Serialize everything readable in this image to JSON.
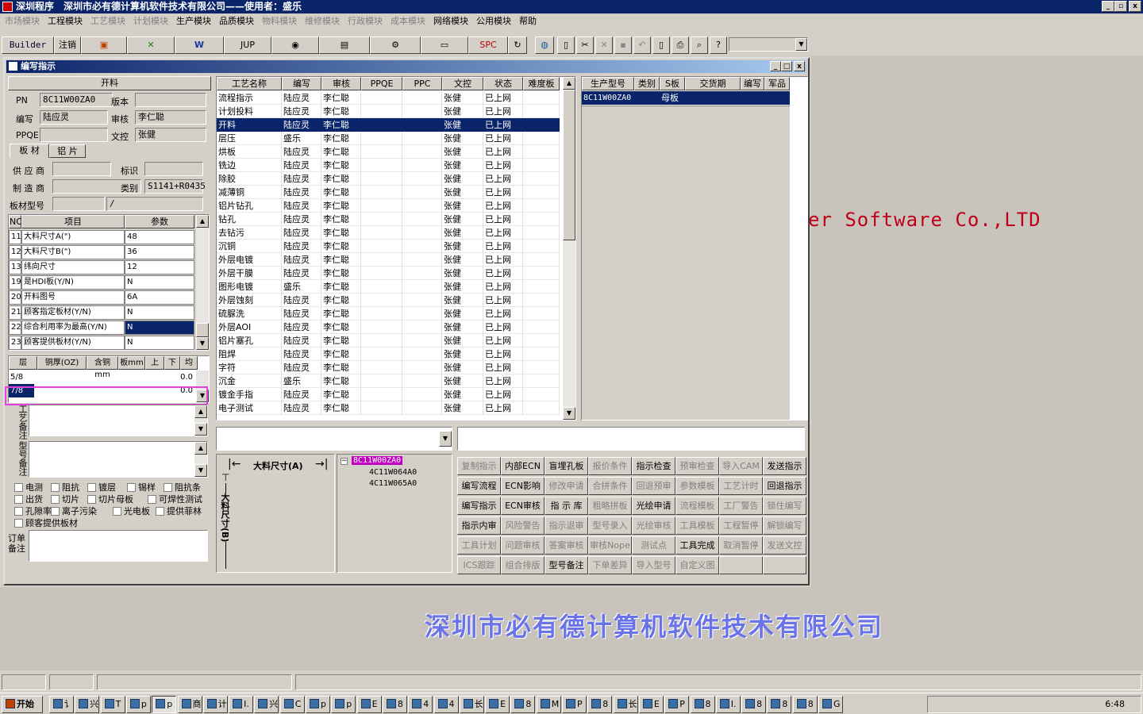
{
  "app": {
    "title": "深圳程序　深圳市必有德计算机软件技术有限公司——使用者：盛乐"
  },
  "menu": [
    {
      "label": "市场模块",
      "dim": true
    },
    {
      "label": "工程模块",
      "dim": false
    },
    {
      "label": "工艺模块",
      "dim": true
    },
    {
      "label": "计划模块",
      "dim": true
    },
    {
      "label": "生产模块",
      "dim": false
    },
    {
      "label": "品质模块",
      "dim": false
    },
    {
      "label": "物料模块",
      "dim": true
    },
    {
      "label": "维修模块",
      "dim": true
    },
    {
      "label": "行政模块",
      "dim": true
    },
    {
      "label": "成本模块",
      "dim": true
    },
    {
      "label": "网络模块",
      "dim": false
    },
    {
      "label": "公用模块",
      "dim": false
    },
    {
      "label": "帮助",
      "dim": false
    }
  ],
  "toolbar": {
    "builder": "Builder",
    "logout": "注销",
    "jup": "JUP",
    "spc": "SPC"
  },
  "desktop": {
    "banner": "er Software Co.,LTD",
    "company": "深圳市必有德计算机软件技术有限公司"
  },
  "window": {
    "title": "编写指示",
    "kailiao": "开料",
    "pn_label": "PN",
    "pn": "8C11W00ZA0",
    "ver_label": "版本",
    "ver": "",
    "writer_label": "编写",
    "writer": "陆应灵",
    "review_label": "审核",
    "review": "李仁聪",
    "ppqe_label": "PPQE",
    "ppqe": "",
    "doc_label": "文控",
    "doc": "张健",
    "tab1": "板 材",
    "tab2": "铝 片",
    "supplier_label": "供 应 商",
    "supplier": "",
    "mark_label": "标识",
    "mark": "",
    "maker_label": "制 造 商",
    "maker": "",
    "type_label": "类别",
    "type": "S1141+R0435",
    "model_label": "板材型号",
    "model": "",
    "model2": "/",
    "param_headers": [
      "NO",
      "项目",
      "参数"
    ],
    "params": [
      [
        "11",
        "大料尺寸A(\")",
        "48"
      ],
      [
        "12",
        "大料尺寸B(\")",
        "36"
      ],
      [
        "13",
        "纬向尺寸",
        "12"
      ],
      [
        "19",
        "是HDI板(Y/N)",
        "N"
      ],
      [
        "20",
        "开料图号",
        "6A"
      ],
      [
        "21",
        "顾客指定板材(Y/N)",
        "N"
      ],
      [
        "22",
        "综合利用率为最高(Y/N)",
        "N"
      ],
      [
        "23",
        "顾客提供板材(Y/N)",
        "N"
      ]
    ],
    "layer_headers": [
      "层",
      "铜厚(OZ)",
      "含铜mm",
      "板mm",
      "上",
      "下",
      "均"
    ],
    "layers": [
      [
        "5/8",
        "0.0"
      ],
      [
        "7/8",
        "0.0"
      ]
    ],
    "side_label1": "工艺备注",
    "side_label2": "型号备注",
    "side_label3": "订单备注",
    "checks": [
      "电测",
      "阻抗",
      "镀层",
      "锡样",
      "阻抗条",
      "出货",
      "切片",
      "切片母板",
      "可焊性测试",
      "孔隙率",
      "离子污染",
      "光电板",
      "提供菲林",
      "顾客提供板材"
    ],
    "proc_headers": [
      "工艺名称",
      "编写",
      "审核",
      "PPQE",
      "PPC",
      "文控",
      "状态",
      "难度板"
    ],
    "procs": [
      [
        "流程指示",
        "陆应灵",
        "李仁聪",
        "",
        "",
        "张健",
        "已上网"
      ],
      [
        "计划投料",
        "陆应灵",
        "李仁聪",
        "",
        "",
        "张健",
        "已上网"
      ],
      [
        "开料",
        "陆应灵",
        "李仁聪",
        "",
        "",
        "张健",
        "已上网"
      ],
      [
        "层压",
        "盛乐",
        "李仁聪",
        "",
        "",
        "张健",
        "已上网"
      ],
      [
        "烘板",
        "陆应灵",
        "李仁聪",
        "",
        "",
        "张健",
        "已上网"
      ],
      [
        "铣边",
        "陆应灵",
        "李仁聪",
        "",
        "",
        "张健",
        "已上网"
      ],
      [
        "除胶",
        "陆应灵",
        "李仁聪",
        "",
        "",
        "张健",
        "已上网"
      ],
      [
        "减薄铜",
        "陆应灵",
        "李仁聪",
        "",
        "",
        "张健",
        "已上网"
      ],
      [
        "铝片钻孔",
        "陆应灵",
        "李仁聪",
        "",
        "",
        "张健",
        "已上网"
      ],
      [
        "钻孔",
        "陆应灵",
        "李仁聪",
        "",
        "",
        "张健",
        "已上网"
      ],
      [
        "去钻污",
        "陆应灵",
        "李仁聪",
        "",
        "",
        "张健",
        "已上网"
      ],
      [
        "沉铜",
        "陆应灵",
        "李仁聪",
        "",
        "",
        "张健",
        "已上网"
      ],
      [
        "外层电镀",
        "陆应灵",
        "李仁聪",
        "",
        "",
        "张健",
        "已上网"
      ],
      [
        "外层干膜",
        "陆应灵",
        "李仁聪",
        "",
        "",
        "张健",
        "已上网"
      ],
      [
        "图形电镀",
        "盛乐",
        "李仁聪",
        "",
        "",
        "张健",
        "已上网"
      ],
      [
        "外层蚀刻",
        "陆应灵",
        "李仁聪",
        "",
        "",
        "张健",
        "已上网"
      ],
      [
        "硫脲洗",
        "陆应灵",
        "李仁聪",
        "",
        "",
        "张健",
        "已上网"
      ],
      [
        "外层AOI",
        "陆应灵",
        "李仁聪",
        "",
        "",
        "张健",
        "已上网"
      ],
      [
        "铝片塞孔",
        "陆应灵",
        "李仁聪",
        "",
        "",
        "张健",
        "已上网"
      ],
      [
        "阻焊",
        "陆应灵",
        "李仁聪",
        "",
        "",
        "张健",
        "已上网"
      ],
      [
        "字符",
        "陆应灵",
        "李仁聪",
        "",
        "",
        "张健",
        "已上网"
      ],
      [
        "沉金",
        "盛乐",
        "李仁聪",
        "",
        "",
        "张健",
        "已上网"
      ],
      [
        "镀金手指",
        "陆应灵",
        "李仁聪",
        "",
        "",
        "张健",
        "已上网"
      ],
      [
        "电子测试",
        "陆应灵",
        "李仁聪",
        "",
        "",
        "张健",
        "已上网"
      ]
    ],
    "prod_headers": [
      "生产型号",
      "类别",
      "S板",
      "交货期",
      "编写",
      "军品"
    ],
    "prod_rows": [
      [
        "8C11W00ZA0",
        "",
        "母板",
        "",
        "",
        ""
      ]
    ],
    "dimA": "大料尺寸(A)",
    "dimB": "大料尺寸(B)",
    "tree": [
      "8C11W00ZA0",
      "4C11W064A0",
      "4C11W065A0"
    ],
    "actions": [
      [
        [
          "复制指示",
          true
        ],
        [
          "内部ECN",
          false
        ],
        [
          "盲埋孔板",
          false
        ],
        [
          "报价条件",
          true
        ],
        [
          "指示检查",
          false
        ],
        [
          "预审检查",
          true
        ],
        [
          "导入CAM",
          true
        ],
        [
          "发送指示",
          false
        ]
      ],
      [
        [
          "编写流程",
          false
        ],
        [
          "ECN影响",
          false
        ],
        [
          "修改申请",
          true
        ],
        [
          "合拼条件",
          true
        ],
        [
          "回退预审",
          true
        ],
        [
          "参数模板",
          true
        ],
        [
          "工艺计时",
          true
        ],
        [
          "回退指示",
          false
        ]
      ],
      [
        [
          "编写指示",
          false
        ],
        [
          "ECN审核",
          false
        ],
        [
          "指 示 库",
          false
        ],
        [
          "粗略拼板",
          true
        ],
        [
          "光绘申请",
          false
        ],
        [
          "流程模板",
          true
        ],
        [
          "工厂警告",
          true
        ],
        [
          "锁住编写",
          true
        ]
      ],
      [
        [
          "指示内审",
          false
        ],
        [
          "风险警告",
          true
        ],
        [
          "指示退审",
          true
        ],
        [
          "型号录入",
          true
        ],
        [
          "光绘审核",
          true
        ],
        [
          "工具模板",
          true
        ],
        [
          "工程暂停",
          true
        ],
        [
          "解锁编写",
          true
        ]
      ],
      [
        [
          "工具计划",
          true
        ],
        [
          "问题审核",
          true
        ],
        [
          "答案审核",
          true
        ],
        [
          "审核Nope",
          true
        ],
        [
          "测试点",
          true
        ],
        [
          "工具完成",
          false
        ],
        [
          "取消暂停",
          true
        ],
        [
          "发送文控",
          true
        ]
      ],
      [
        [
          "ICS跟踪",
          true
        ],
        [
          "组合排版",
          true
        ],
        [
          "型号备注",
          false
        ],
        [
          "下单差异",
          true
        ],
        [
          "导入型号",
          true
        ],
        [
          "自定义图",
          true
        ],
        [
          "",
          false
        ],
        [
          "",
          false
        ]
      ]
    ]
  },
  "taskbar": {
    "start": "开始",
    "clock": "6:48",
    "items": [
      "讠",
      "兴",
      "T",
      "p",
      "p",
      "商",
      "计",
      "I.",
      "兴",
      "C",
      "p",
      "p",
      "E",
      "8",
      "4",
      "4",
      "长",
      "E",
      "8",
      "M",
      "P",
      "8",
      "长",
      "E",
      "P",
      "8",
      "I.",
      "8",
      "8",
      "8",
      "G"
    ]
  }
}
